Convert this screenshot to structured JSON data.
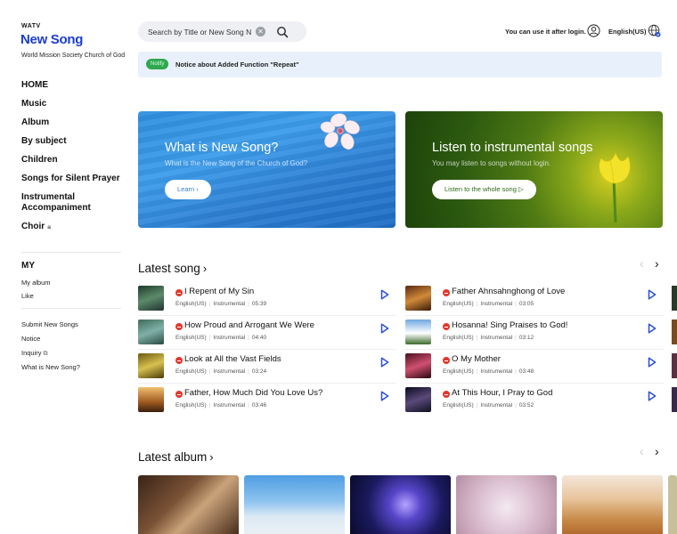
{
  "brand": {
    "small": "WATV",
    "name": "New Song",
    "org": "World Mission Society Church of God"
  },
  "nav": {
    "items": [
      "HOME",
      "Music",
      "Album",
      "By subject",
      "Children",
      "Songs for Silent Prayer",
      "Instrumental Accompaniment",
      "Choir"
    ],
    "my_title": "MY",
    "my_items": [
      "My album",
      "Like"
    ],
    "footer_items": [
      "Submit New Songs",
      "Notice",
      "Inquiry",
      "What is New Song?"
    ]
  },
  "header": {
    "search_placeholder": "Search by Title or New Song N",
    "login_note": "You can use it after login.",
    "language": "English(US)"
  },
  "notice": {
    "badge": "Notify",
    "text": "Notice about Added Function \"Repeat\""
  },
  "banners": [
    {
      "title": "What is New Song?",
      "subtitle": "What is the New Song of the Church of God?",
      "button": "Learn",
      "button_icon": "chevron-right-icon"
    },
    {
      "title": "Listen to instrumental songs",
      "subtitle": "You may listen to songs without login.",
      "button": "Listen to the whole song",
      "button_icon": "play-small-icon"
    }
  ],
  "latest_song": {
    "title": "Latest song",
    "songs": [
      {
        "title": "I Repent of My Sin",
        "lang": "English(US)",
        "type": "Instrumental",
        "duration": "05:39"
      },
      {
        "title": "Father Ahnsahnghong of Love",
        "lang": "English(US)",
        "type": "Instrumental",
        "duration": "03:05"
      },
      {
        "title": "How Proud and Arrogant We Were",
        "lang": "English(US)",
        "type": "Instrumental",
        "duration": "04:40"
      },
      {
        "title": "Hosanna! Sing Praises to God!",
        "lang": "English(US)",
        "type": "Instrumental",
        "duration": "03:12"
      },
      {
        "title": "Look at All the Vast Fields",
        "lang": "English(US)",
        "type": "Instrumental",
        "duration": "03:24"
      },
      {
        "title": "O My Mother",
        "lang": "English(US)",
        "type": "Instrumental",
        "duration": "03:48"
      },
      {
        "title": "Father, How Much Did You Love Us?",
        "lang": "English(US)",
        "type": "Instrumental",
        "duration": "03:46"
      },
      {
        "title": "At This Hour, I Pray to God",
        "lang": "English(US)",
        "type": "Instrumental",
        "duration": "03:52"
      }
    ]
  },
  "latest_album": {
    "title": "Latest album"
  },
  "colors": {
    "brand": "#1b3dcf",
    "accent_play": "#2b4fd8",
    "badge_red": "#e4372c",
    "notify_green": "#2fa84f",
    "notice_bg": "#e8f1fb"
  }
}
